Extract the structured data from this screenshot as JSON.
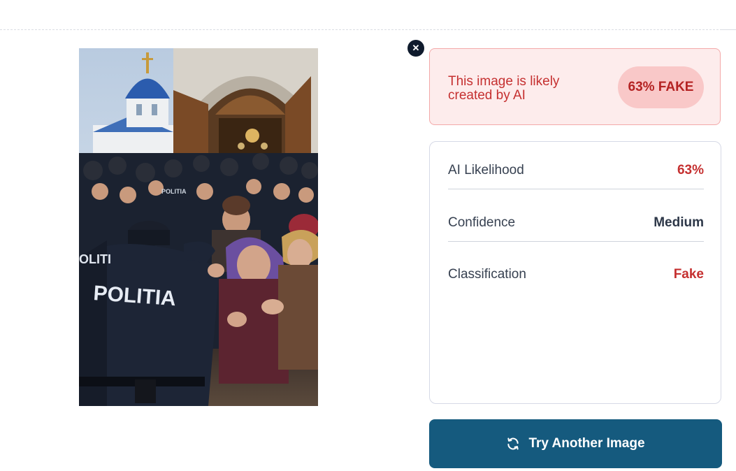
{
  "result": {
    "close_icon": "close-icon",
    "verdict_text": "This image is likely created by AI",
    "badge_label": "63% FAKE",
    "colors": {
      "fake_red": "#c53030",
      "badge_bg": "#f9c8c8",
      "card_bg": "#fdecec",
      "button_bg": "#155a7e"
    }
  },
  "details": {
    "rows": [
      {
        "label": "AI Likelihood",
        "value": "63%"
      },
      {
        "label": "Confidence",
        "value": "Medium"
      },
      {
        "label": "Classification",
        "value": "Fake"
      }
    ]
  },
  "photo": {
    "jacket_text": "POLITIA",
    "jacket_text_partial": "OLITI",
    "cap_text": "POLITIA"
  },
  "action": {
    "button_label": "Try Another Image",
    "button_icon": "refresh-icon"
  }
}
